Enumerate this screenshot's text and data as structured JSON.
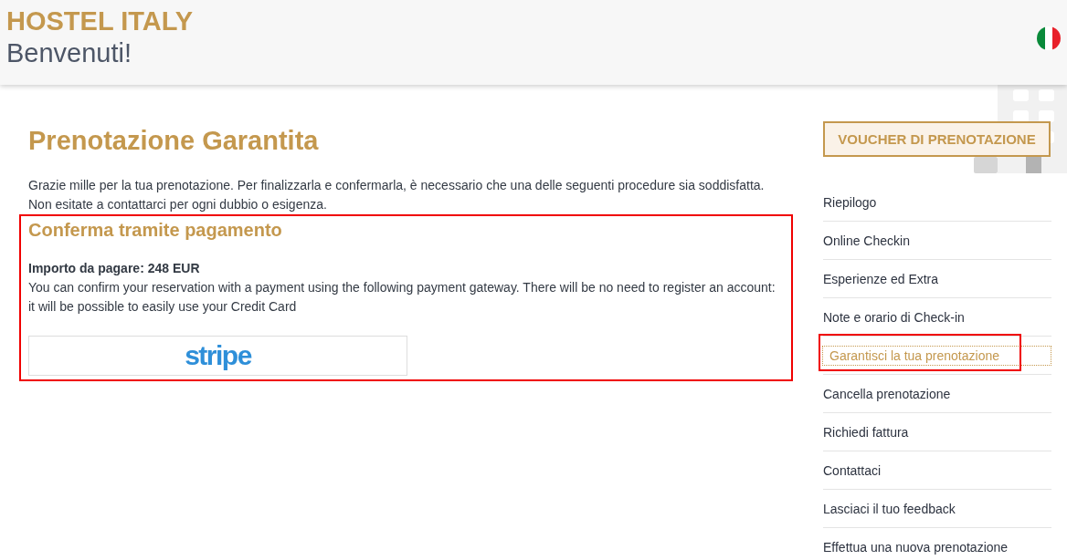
{
  "header": {
    "title": "HOSTEL ITALY",
    "subtitle": "Benvenuti!"
  },
  "main": {
    "heading": "Prenotazione Garantita",
    "intro": [
      "Grazie mille per la tua prenotazione. Per finalizzarla e confermarla, è necessario che una delle seguenti procedure sia soddisfatta.",
      "Non esitate a contattarci per ogni dubbio o esigenza."
    ],
    "payment": {
      "highlighted": true,
      "heading": "Conferma tramite pagamento",
      "amount": "Importo da pagare: 248 EUR",
      "description": "You can confirm your reservation with a payment using the following payment gateway. There will be no need to register an account: it will be possible to easily use your Credit Card",
      "gateway_button": "stripe"
    }
  },
  "sidebar": {
    "voucher_button": "VOUCHER DI PRENOTAZIONE",
    "items": [
      {
        "label": "Riepilogo",
        "selected": false,
        "highlighted": false
      },
      {
        "label": "Online Checkin",
        "selected": false,
        "highlighted": false
      },
      {
        "label": "Esperienze ed Extra",
        "selected": false,
        "highlighted": false
      },
      {
        "label": "Note e orario di Check-in",
        "selected": false,
        "highlighted": false
      },
      {
        "label": "Garantisci la tua prenotazione",
        "selected": true,
        "highlighted": true
      },
      {
        "label": "Cancella prenotazione",
        "selected": false,
        "highlighted": false
      },
      {
        "label": "Richiedi fattura",
        "selected": false,
        "highlighted": false
      },
      {
        "label": "Contattaci",
        "selected": false,
        "highlighted": false
      },
      {
        "label": "Lasciaci il tuo feedback",
        "selected": false,
        "highlighted": false
      },
      {
        "label": "Effettua una nuova prenotazione",
        "selected": false,
        "highlighted": false
      }
    ]
  }
}
